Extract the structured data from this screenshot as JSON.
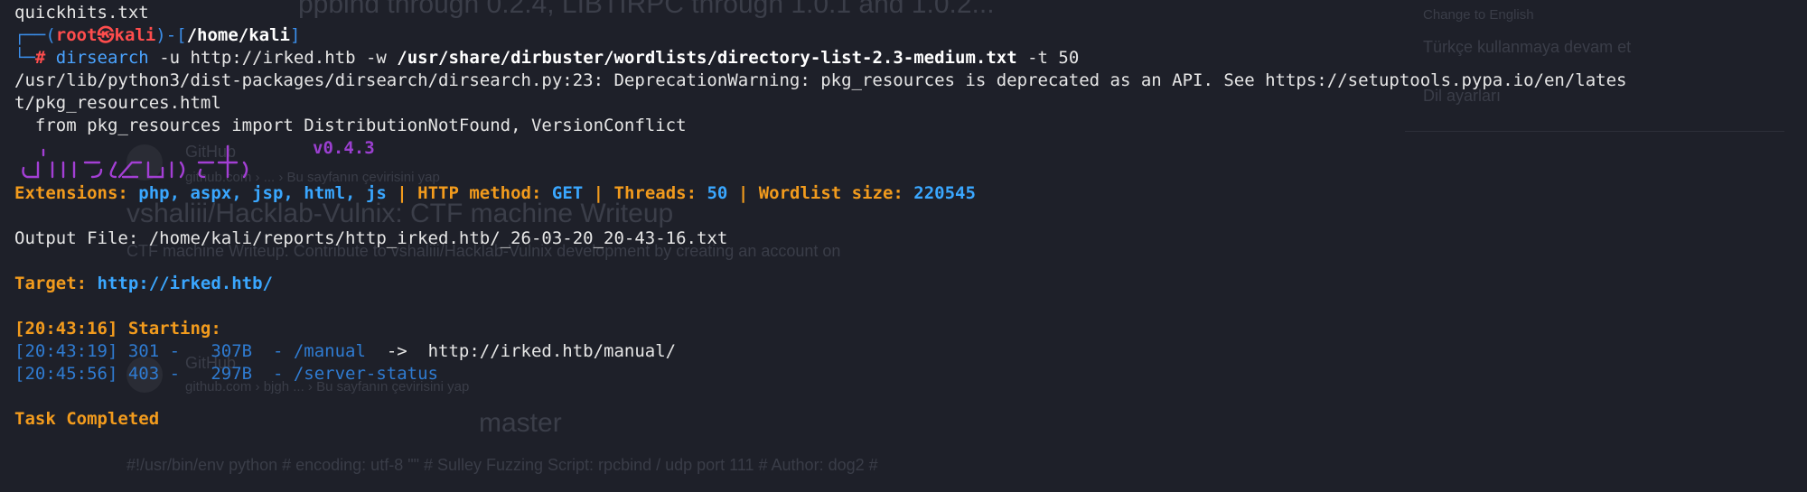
{
  "background": {
    "color": "#1e2029",
    "ghost_texts": [
      "ppbind through 0.2.4, LIBTIRPC through 1.0.1 and 1.0.2...",
      "Change to English",
      "Türkçe kullanmaya devam et",
      "Dil ayarları",
      "GitHub",
      "github.com › ... › Bu sayfanın çevirisini yap",
      "vshaliii/Hacklab-Vulnix: CTF machine Writeup",
      "CTF machine Writeup. Contribute to vshaliii/Hacklab-Vulnix development by creating an account on",
      "GitHub",
      "github.com › bjgh ... › Bu sayfanın çevirisini yap",
      "master",
      "#!/usr/bin/env python # encoding: utf-8 \"\" # Sulley Fuzzing Script: rpcbind / udp port 111 # Author: dog2 #"
    ]
  },
  "terminal": {
    "line_prev": "quickhits.txt",
    "prompt": {
      "open": "┌──(",
      "user": "root㉿kali",
      "close": ")-[",
      "dir": "/home/kali",
      "end": "]",
      "hash_prefix": "└─",
      "hash": "#"
    },
    "command": {
      "bin": "dirsearch",
      "args1": " -u http://irked.htb -w ",
      "wordlist": "/usr/share/dirbuster/wordlists/directory-list-2.3-medium.txt",
      "args2": " -t 50"
    },
    "warning_line1": "/usr/lib/python3/dist-packages/dirsearch/dirsearch.py:23: DeprecationWarning: pkg_resources is deprecated as an API. See https://setuptools.pypa.io/en/lates",
    "warning_line2": "t/pkg_resources.html",
    "warning_line3": "  from pkg_resources import DistributionNotFound, VersionConflict",
    "version": "v0.4.3",
    "info": {
      "ext_label": "Extensions: ",
      "ext_value": "php, aspx, jsp, html, js",
      "sep": " | ",
      "method_label": "HTTP method: ",
      "method_value": "GET",
      "threads_label": "Threads: ",
      "threads_value": "50",
      "wordlist_label": "Wordlist size: ",
      "wordlist_value": "220545"
    },
    "output_file": "Output File: /home/kali/reports/http_irked.htb/_26-03-20_20-43-16.txt",
    "target_label": "Target: ",
    "target_value": "http://irked.htb/",
    "starting": "[20:43:16] Starting:",
    "results": [
      {
        "line": "[20:43:19] 301 -   307B  - /manual  ",
        "redirect": "->  http://irked.htb/manual/"
      },
      {
        "line": "[20:45:56] 403 -   297B  - /server-status",
        "redirect": ""
      }
    ],
    "completed": "Task Completed"
  }
}
